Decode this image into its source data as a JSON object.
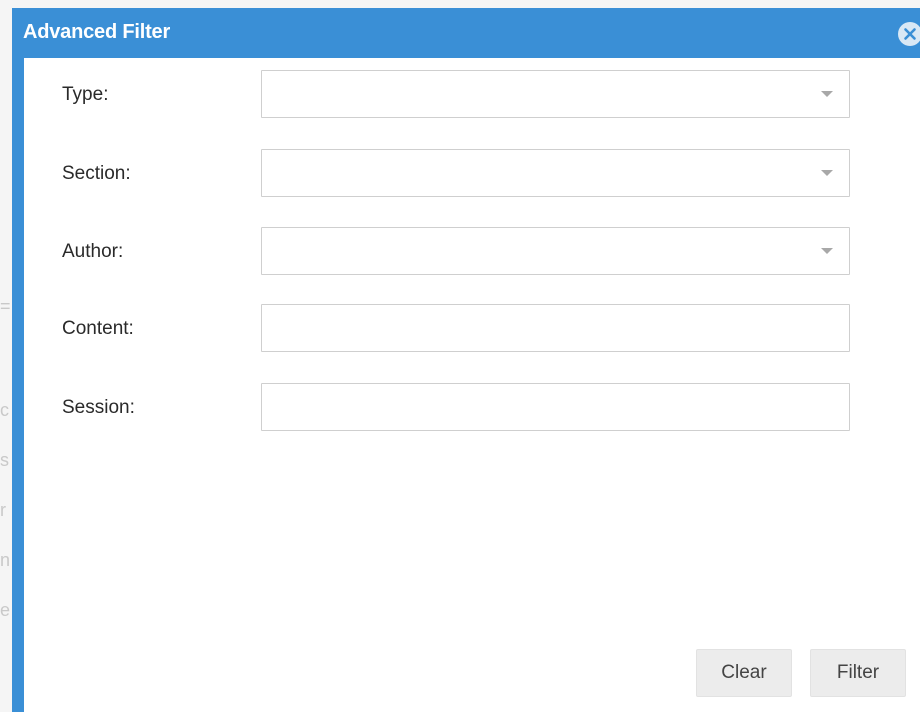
{
  "dialog": {
    "title": "Advanced Filter",
    "close_icon": "close-circle-icon",
    "accent_color": "#3a8fd6"
  },
  "fields": [
    {
      "label": "Type:",
      "kind": "select",
      "value": "",
      "placeholder": ""
    },
    {
      "label": "Section:",
      "kind": "select",
      "value": "",
      "placeholder": ""
    },
    {
      "label": "Author:",
      "kind": "select",
      "value": "",
      "placeholder": ""
    },
    {
      "label": "Content:",
      "kind": "text",
      "value": "",
      "placeholder": ""
    },
    {
      "label": "Session:",
      "kind": "text",
      "value": "",
      "placeholder": ""
    }
  ],
  "buttons": {
    "clear_label": "Clear",
    "filter_label": "Filter"
  }
}
